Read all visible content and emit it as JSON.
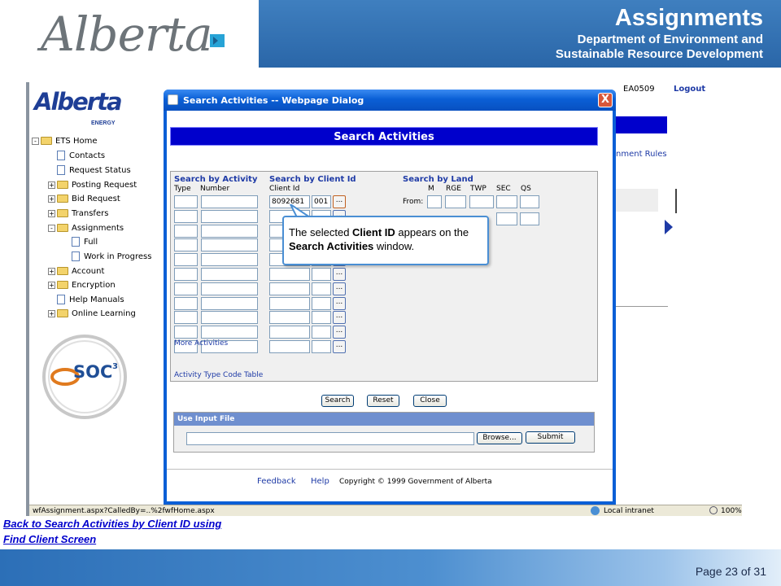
{
  "header": {
    "logo_text": "Alberta",
    "title": "Assignments",
    "subtitle_line1": "Department of Environment and",
    "subtitle_line2": "Sustainable Resource Development"
  },
  "app": {
    "logo_text": "Alberta",
    "logo_sub": "ENERGY",
    "user_id": "EA0509",
    "logout": "Logout",
    "rules_link": "nment Rules",
    "tree": [
      {
        "label": "ETS Home",
        "kind": "folder",
        "toggle": "-",
        "level": 0
      },
      {
        "label": "Contacts",
        "kind": "page",
        "level": 1
      },
      {
        "label": "Request Status",
        "kind": "page",
        "level": 1
      },
      {
        "label": "Posting Request",
        "kind": "folder",
        "toggle": "+",
        "level": 1
      },
      {
        "label": "Bid Request",
        "kind": "folder",
        "toggle": "+",
        "level": 1
      },
      {
        "label": "Transfers",
        "kind": "folder",
        "toggle": "+",
        "level": 1
      },
      {
        "label": "Assignments",
        "kind": "folder",
        "toggle": "-",
        "level": 1
      },
      {
        "label": "Full",
        "kind": "page",
        "level": 2
      },
      {
        "label": "Work in Progress",
        "kind": "page",
        "level": 2
      },
      {
        "label": "Account",
        "kind": "folder",
        "toggle": "+",
        "level": 1
      },
      {
        "label": "Encryption",
        "kind": "folder",
        "toggle": "+",
        "level": 1
      },
      {
        "label": "Help Manuals",
        "kind": "page",
        "level": 1
      },
      {
        "label": "Online Learning",
        "kind": "folder",
        "toggle": "+",
        "level": 1
      }
    ],
    "soc_text": "SOC",
    "soc_sup": "3",
    "status_url": "wfAssignment.aspx?CalledBy=..%2fwfHome.aspx",
    "status_zone": "Local intranet",
    "status_zoom": "100%"
  },
  "dialog": {
    "title": "Search Activities -- Webpage Dialog",
    "close": "X",
    "heading": "Search Activities",
    "by_activity": {
      "title": "Search by Activity",
      "col_type": "Type",
      "col_number": "Number",
      "more": "More Activities",
      "code_table": "Activity Type Code Table"
    },
    "by_client": {
      "title": "Search by Client Id",
      "label": "Client Id",
      "client_id": "8092681",
      "suffix": "001",
      "ellipsis": "..."
    },
    "by_land": {
      "title": "Search by Land",
      "col_m": "M",
      "col_rge": "RGE",
      "col_twp": "TWP",
      "col_sec": "SEC",
      "col_qs": "QS",
      "from": "From:"
    },
    "buttons": {
      "search": "Search",
      "reset": "Reset",
      "close": "Close"
    },
    "input_file": {
      "title": "Use Input File",
      "browse": "Browse...",
      "submit": "Submit"
    },
    "footer": {
      "feedback": "Feedback",
      "help": "Help",
      "copyright": "Copyright © 1999 Government of Alberta"
    }
  },
  "callout": {
    "t1": "The selected ",
    "b1": "Client ID",
    "t2": " appears on the",
    "b2": "Search Activities",
    "t3": " window."
  },
  "slide": {
    "link_line1": "Back to Search Activities by Client ID using",
    "link_line2": "Find Client Screen",
    "page": "Page 23 of 31"
  }
}
